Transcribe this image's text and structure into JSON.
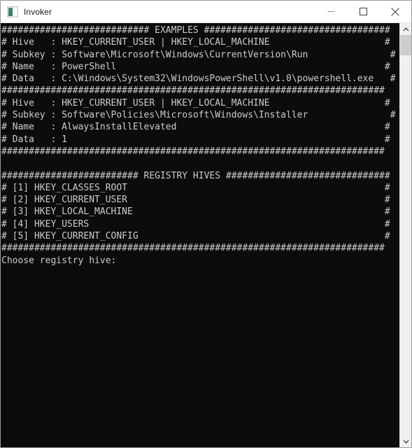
{
  "window": {
    "title": "Invoker",
    "icon": "app-icon",
    "controls": {
      "minimize": "minimize-icon",
      "maximize": "maximize-icon",
      "close": "close-icon"
    }
  },
  "scrollbar": {
    "up_arrow": "chevron-up-icon",
    "down_arrow": "chevron-down-icon",
    "thumb": "scrollbar-thumb"
  },
  "console": {
    "prompt": "Choose registry hive:",
    "sections": [
      {
        "heading": "EXAMPLES",
        "examples": [
          {
            "Hive": "HKEY_CURRENT_USER | HKEY_LOCAL_MACHINE",
            "Subkey": "Software\\Microsoft\\Windows\\CurrentVersion\\Run",
            "Name": "PowerShell",
            "Data": "C:\\Windows\\System32\\WindowsPowerShell\\v1.0\\powershell.exe"
          },
          {
            "Hive": "HKEY_CURRENT_USER | HKEY_LOCAL_MACHINE",
            "Subkey": "Software\\Policies\\Microsoft\\Windows\\Installer",
            "Name": "AlwaysInstallElevated",
            "Data": "1"
          }
        ]
      },
      {
        "heading": "REGISTRY HIVES",
        "hives": [
          {
            "index": "[1]",
            "name": "HKEY_CLASSES_ROOT"
          },
          {
            "index": "[2]",
            "name": "HKEY_CURRENT_USER"
          },
          {
            "index": "[3]",
            "name": "HKEY_LOCAL_MACHINE"
          },
          {
            "index": "[4]",
            "name": "HKEY_USERS"
          },
          {
            "index": "[5]",
            "name": "HKEY_CURRENT_CONFIG"
          }
        ]
      }
    ],
    "raw_lines": [
      "########################### EXAMPLES ##################################",
      "# Hive   : HKEY_CURRENT_USER | HKEY_LOCAL_MACHINE                     #",
      "# Subkey : Software\\Microsoft\\Windows\\CurrentVersion\\Run               #",
      "# Name   : PowerShell                                                 #",
      "# Data   : C:\\Windows\\System32\\WindowsPowerShell\\v1.0\\powershell.exe   #",
      "######################################################################",
      "# Hive   : HKEY_CURRENT_USER | HKEY_LOCAL_MACHINE                     #",
      "# Subkey : Software\\Policies\\Microsoft\\Windows\\Installer               #",
      "# Name   : AlwaysInstallElevated                                      #",
      "# Data   : 1                                                          #",
      "######################################################################",
      "",
      "######################### REGISTRY HIVES ##############################",
      "# [1] HKEY_CLASSES_ROOT                                               #",
      "# [2] HKEY_CURRENT_USER                                               #",
      "# [3] HKEY_LOCAL_MACHINE                                              #",
      "# [4] HKEY_USERS                                                      #",
      "# [5] HKEY_CURRENT_CONFIG                                             #",
      "######################################################################",
      "Choose registry hive: "
    ]
  },
  "colors": {
    "console_bg": "#0c0c0c",
    "console_fg": "#cccccc",
    "titlebar_bg": "#ffffff",
    "window_border": "#9a9a9a",
    "scrollbar_track": "#f0f0f0",
    "scrollbar_thumb": "#cdcdcd"
  }
}
